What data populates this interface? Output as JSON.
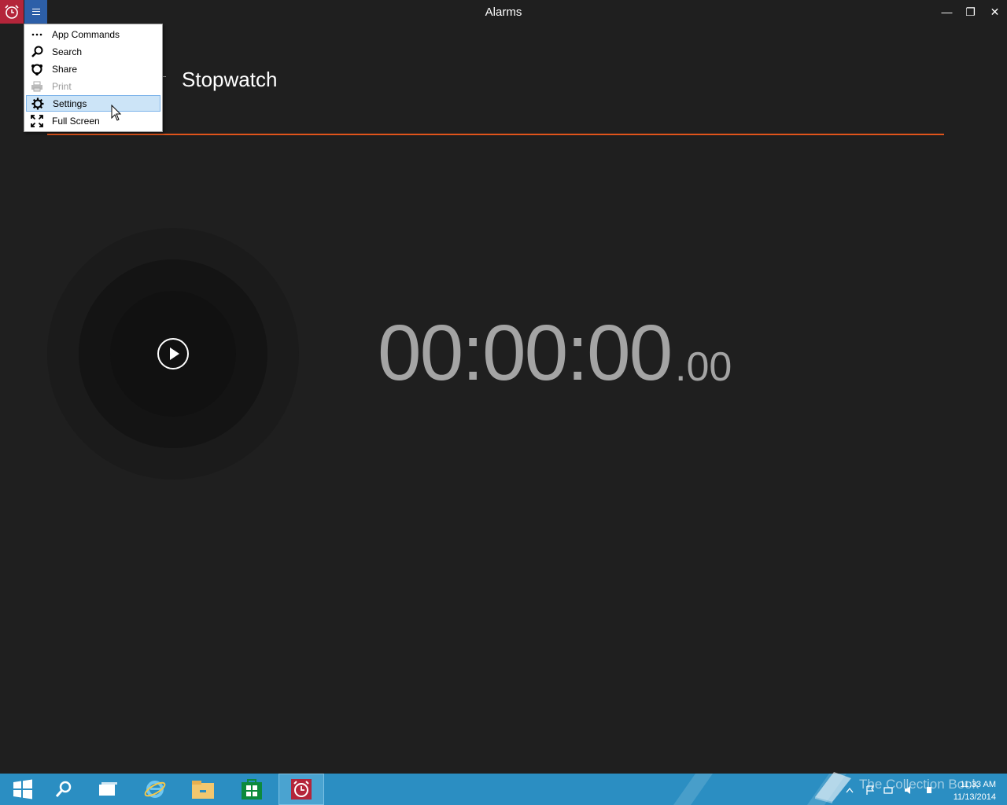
{
  "window": {
    "title": "Alarms",
    "minimize_glyph": "—",
    "maximize_glyph": "❐",
    "close_glyph": "✕"
  },
  "page": {
    "heading": "Stopwatch",
    "accent_color": "#e0541b"
  },
  "stopwatch": {
    "time_main": "00:00:00",
    "time_fraction": ".00",
    "play_icon": "play-icon"
  },
  "menu": {
    "items": [
      {
        "label": "App Commands",
        "icon": "ellipsis-icon",
        "enabled": true
      },
      {
        "label": "Search",
        "icon": "search-icon",
        "enabled": true
      },
      {
        "label": "Share",
        "icon": "share-icon",
        "enabled": true
      },
      {
        "label": "Print",
        "icon": "print-icon",
        "enabled": false
      },
      {
        "label": "Settings",
        "icon": "gear-icon",
        "enabled": true,
        "highlighted": true
      },
      {
        "label": "Full Screen",
        "icon": "fullscreen-icon",
        "enabled": true
      }
    ]
  },
  "taskbar": {
    "items": [
      "start-icon",
      "search-icon",
      "task-view-icon",
      "internet-explorer-icon",
      "file-explorer-icon",
      "store-icon",
      "alarms-icon"
    ],
    "active": "alarms-icon",
    "clock_time": "11:33 AM",
    "clock_date": "11/13/2014",
    "watermark": "The Collection Book"
  },
  "colors": {
    "titlebar_bg": "#1f1f1f",
    "app_icon_bg": "#b4253a",
    "hamburger_bg": "#2d5fa8",
    "taskbar_bg": "#2b8ec2"
  }
}
